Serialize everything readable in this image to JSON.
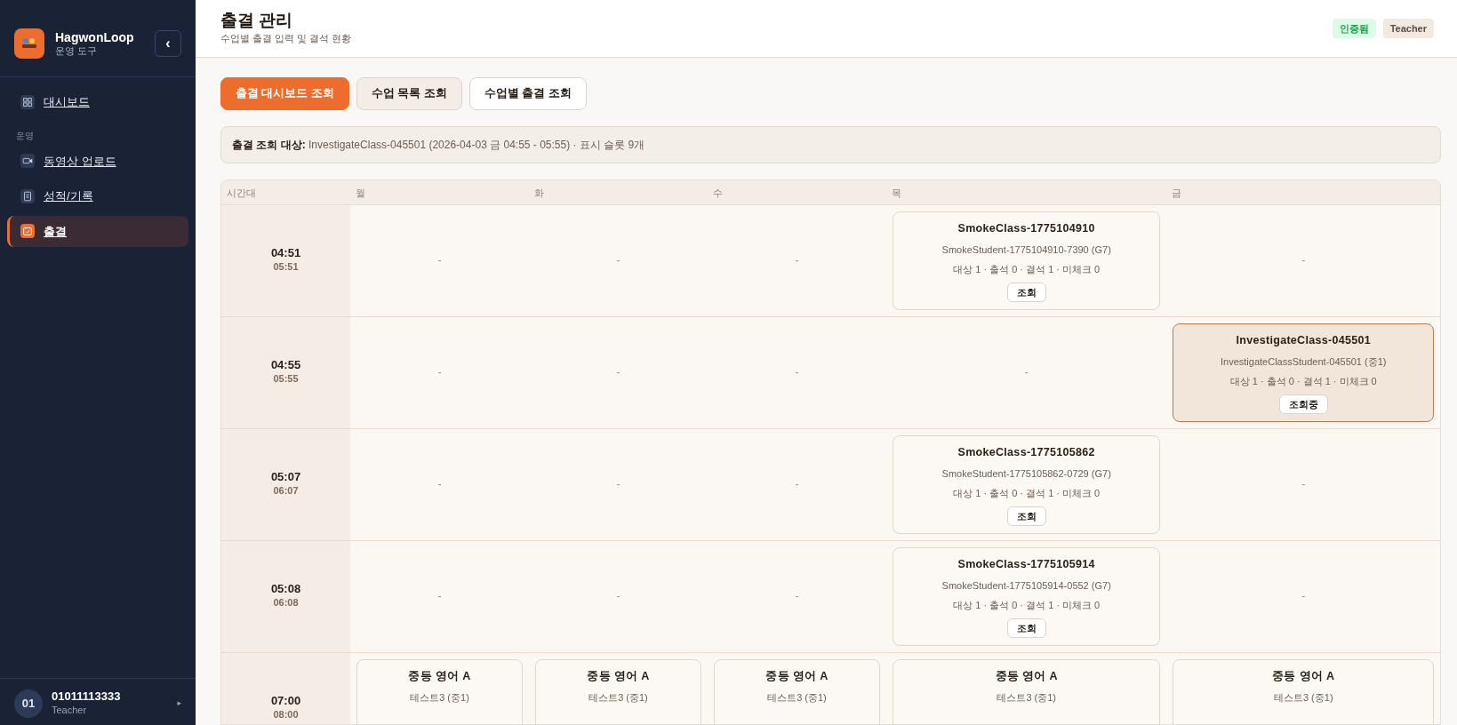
{
  "sidebar": {
    "brand": {
      "name": "HagwonLoop",
      "subtitle": "운영 도구",
      "collapse": "‹"
    },
    "items": [
      {
        "kind": "dashboard",
        "label": "대시보드",
        "selected": false
      },
      {
        "kind": "section",
        "label": "운영"
      },
      {
        "kind": "video",
        "label": "동영상 업로드",
        "selected": false
      },
      {
        "kind": "records",
        "label": "성적/기록",
        "selected": false
      },
      {
        "kind": "attendance",
        "label": "출결",
        "selected": true
      }
    ],
    "user": {
      "initials": "01",
      "name": "01011113333",
      "role": "Teacher",
      "arrow": "▸"
    }
  },
  "header": {
    "title": "출결 관리",
    "subtitle": "수업별 출결 입력 및 결석 현황",
    "badges": [
      {
        "kind": "verified",
        "label": "인증됨"
      },
      {
        "kind": "role",
        "label": "Teacher"
      }
    ]
  },
  "tabs": [
    {
      "label": "출결 대시보드 조회",
      "selected": true,
      "hovered": false
    },
    {
      "label": "수업 목록 조회",
      "selected": false,
      "hovered": true
    },
    {
      "label": "수업별 출결 조회",
      "selected": false,
      "hovered": false
    }
  ],
  "info": {
    "label": "출결 조회 대상:",
    "text": "InvestigateClass-045501 (2026-04-03 금 04:55 - 05:55) · 표시 슬롯 9개"
  },
  "schedule": {
    "columns": [
      "시간대",
      "월",
      "화",
      "수",
      "목",
      "금"
    ],
    "rows": [
      {
        "start": "04:51",
        "end": "05:51",
        "cells": [
          {
            "kind": "empty",
            "text": "-"
          },
          {
            "kind": "empty",
            "text": "-"
          },
          {
            "kind": "empty",
            "text": "-"
          },
          {
            "kind": "class",
            "title": "SmokeClass-1775104910",
            "student": "SmokeStudent-1775104910-7390 (G7)",
            "summary": "대상 1 · 출석 0 · 결석 1 · 미체크 0",
            "button": "조회",
            "selected": false
          },
          {
            "kind": "empty",
            "text": "-"
          }
        ]
      },
      {
        "start": "04:55",
        "end": "05:55",
        "cells": [
          {
            "kind": "empty",
            "text": "-"
          },
          {
            "kind": "empty",
            "text": "-"
          },
          {
            "kind": "empty",
            "text": "-"
          },
          {
            "kind": "empty",
            "text": "-"
          },
          {
            "kind": "class",
            "title": "InvestigateClass-045501",
            "student": "InvestigateClassStudent-045501 (중1)",
            "summary": "대상 1 · 출석 0 · 결석 1 · 미체크 0",
            "button": "조회중",
            "selected": true
          }
        ]
      },
      {
        "start": "05:07",
        "end": "06:07",
        "cells": [
          {
            "kind": "empty",
            "text": "-"
          },
          {
            "kind": "empty",
            "text": "-"
          },
          {
            "kind": "empty",
            "text": "-"
          },
          {
            "kind": "class",
            "title": "SmokeClass-1775105862",
            "student": "SmokeStudent-1775105862-0729 (G7)",
            "summary": "대상 1 · 출석 0 · 결석 1 · 미체크 0",
            "button": "조회",
            "selected": false
          },
          {
            "kind": "empty",
            "text": "-"
          }
        ]
      },
      {
        "start": "05:08",
        "end": "06:08",
        "cells": [
          {
            "kind": "empty",
            "text": "-"
          },
          {
            "kind": "empty",
            "text": "-"
          },
          {
            "kind": "empty",
            "text": "-"
          },
          {
            "kind": "class",
            "title": "SmokeClass-1775105914",
            "student": "SmokeStudent-1775105914-0552 (G7)",
            "summary": "대상 1 · 출석 0 · 결석 1 · 미체크 0",
            "button": "조회",
            "selected": false
          },
          {
            "kind": "empty",
            "text": "-"
          }
        ]
      },
      {
        "start": "07:00",
        "end": "08:00",
        "cells": [
          {
            "kind": "class",
            "title": "중등 영어 A",
            "student": "테스트3 (중1)",
            "selected": false
          },
          {
            "kind": "class",
            "title": "중등 영어 A",
            "student": "테스트3 (중1)",
            "selected": false
          },
          {
            "kind": "class",
            "title": "중등 영어 A",
            "student": "테스트3 (중1)",
            "selected": false
          },
          {
            "kind": "class",
            "title": "중등 영어 A",
            "student": "테스트3 (중1)",
            "selected": false
          },
          {
            "kind": "class",
            "title": "중등 영어 A",
            "student": "테스트3 (중1)",
            "selected": false
          }
        ]
      }
    ]
  }
}
